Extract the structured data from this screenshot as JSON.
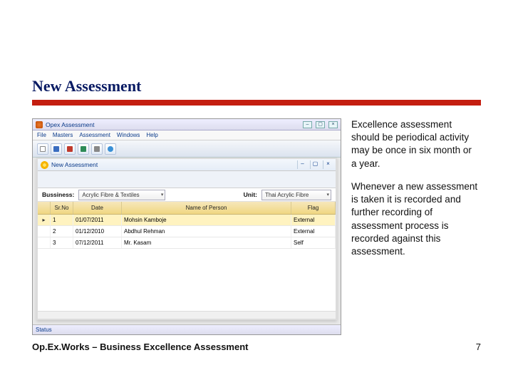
{
  "slide": {
    "title": "New Assessment",
    "para1": "Excellence assessment should be periodical activity may be once in six month or a year.",
    "para2": "Whenever a new assessment is taken it is recorded and further recording of assessment process is recorded against this assessment.",
    "footer_left": "Op.Ex.Works – Business Excellence Assessment",
    "page_no": "7"
  },
  "app": {
    "main_title": "Opex Assessment",
    "menus": [
      "File",
      "Masters",
      "Assessment",
      "Windows",
      "Help"
    ],
    "sub_title": "New Assessment",
    "business_label": "Bussiness:",
    "business_value": "Acrylic Fibre & Textiles",
    "unit_label": "Unit:",
    "unit_value": "Thai Acrylic Fibre",
    "cols": {
      "sr": "Sr.No",
      "date": "Date",
      "name": "Name of Person",
      "flag": "Flag"
    },
    "rows": [
      {
        "sr": "1",
        "date": "01/07/2011",
        "name": "Mohsin Kamboje",
        "flag": "External"
      },
      {
        "sr": "2",
        "date": "01/12/2010",
        "name": "Abdhul Rehman",
        "flag": "External"
      },
      {
        "sr": "3",
        "date": "07/12/2011",
        "name": "Mr. Kasam",
        "flag": "Self"
      }
    ],
    "status": "Status"
  }
}
